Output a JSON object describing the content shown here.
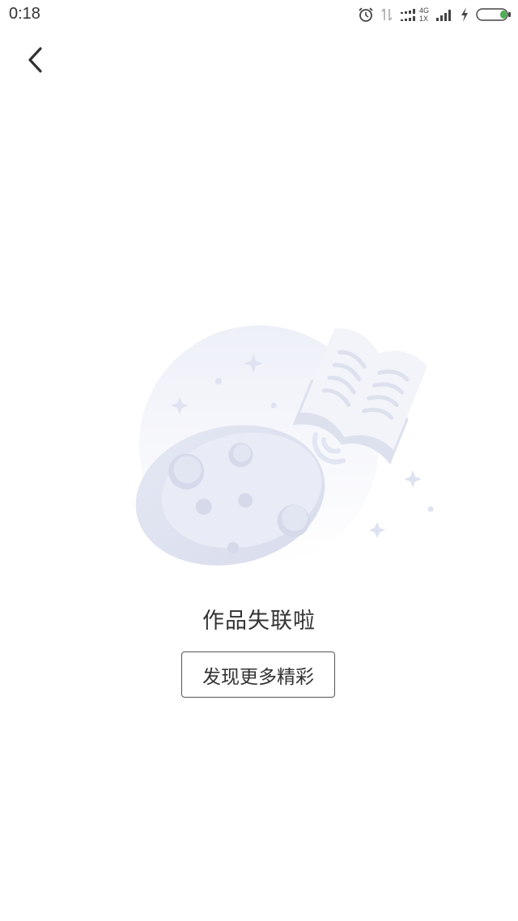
{
  "status_bar": {
    "time": "0:18",
    "network_top": "4G",
    "network_bottom": "1X",
    "icons": [
      "alarm-icon",
      "data-arrows-icon",
      "signal-4g-icon",
      "signal-icon",
      "charging-icon",
      "battery-icon"
    ],
    "battery_color": "#4caf50"
  },
  "header": {
    "back_icon": "chevron-left-icon"
  },
  "empty_state": {
    "illustration": "moon-and-book-illustration",
    "message": "作品失联啦",
    "button_label": "发现更多精彩"
  },
  "colors": {
    "background": "#ffffff",
    "illustration_tint": "#e6e9f4",
    "text": "#333333"
  }
}
